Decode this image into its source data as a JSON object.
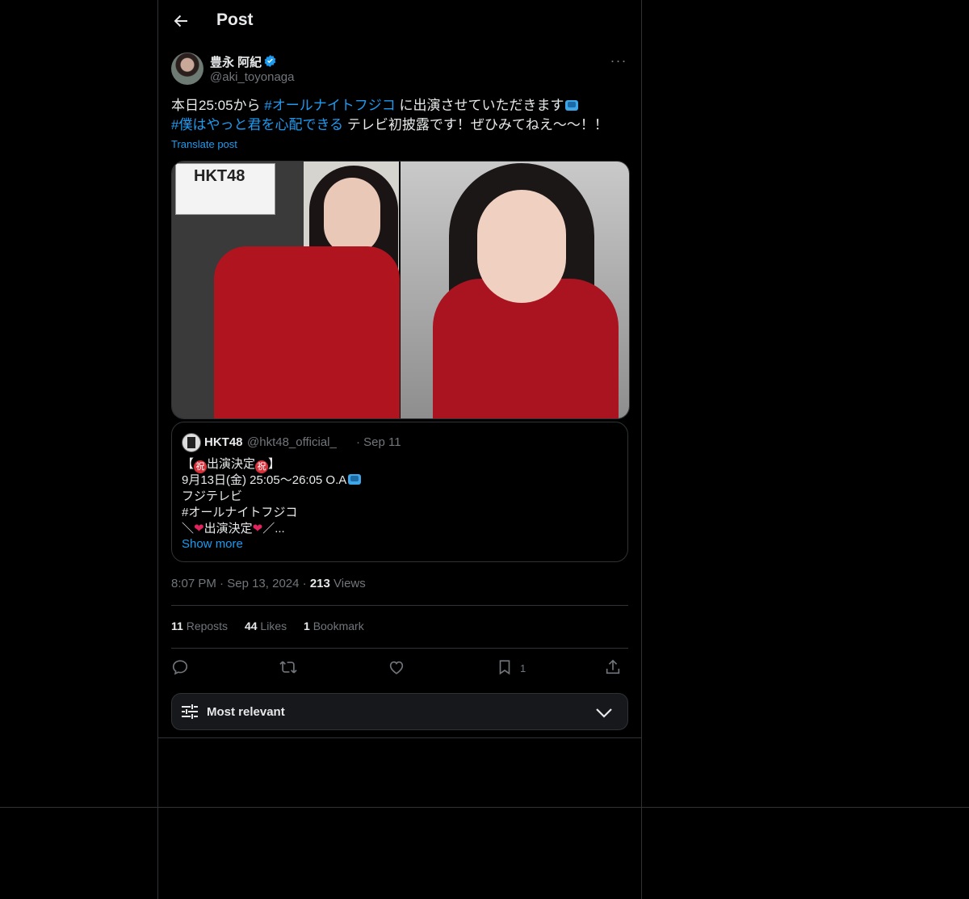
{
  "header": {
    "title": "Post"
  },
  "author": {
    "name": "豊永 阿紀",
    "handle": "@aki_toyonaga"
  },
  "tweet": {
    "line1_a": "本日25:05から ",
    "line1_tag": "#オールナイトフジコ",
    "line1_b": " に出演させていただきます",
    "line2_tag": "#僕はやっと君を心配できる",
    "line2_b": " テレビ初披露です！ぜひみてねえ〜〜！！",
    "translate": "Translate post"
  },
  "media": {
    "sign_text": "HKT48"
  },
  "quote": {
    "name": "HKT48",
    "handle": "@hkt48_official_",
    "date": "· Sep 11",
    "line1_pre": "【",
    "line1_mark": "祝",
    "line1_mid": "出演決定",
    "line1_post": "】",
    "line2": "9月13日(金) 25:05〜26:05 O.A",
    "line3": "フジテレビ",
    "line4": "#オールナイトフジコ",
    "line5_pre": "＼",
    "line5_mid": "出演決定",
    "line5_post": "／...",
    "show_more": "Show more"
  },
  "meta": {
    "time": "8:07 PM",
    "date": "Sep 13, 2024",
    "views_count": "213",
    "views_label": "Views"
  },
  "stats": {
    "reposts_count": "11",
    "reposts_label": "Reposts",
    "likes_count": "44",
    "likes_label": "Likes",
    "bookmarks_count": "1",
    "bookmarks_label": "Bookmark"
  },
  "actions": {
    "bookmark_count": "1"
  },
  "sort": {
    "label": "Most relevant"
  },
  "colors": {
    "accent": "#1d9bf0",
    "background": "#000000",
    "border": "#2f3336",
    "muted": "#71767b"
  }
}
